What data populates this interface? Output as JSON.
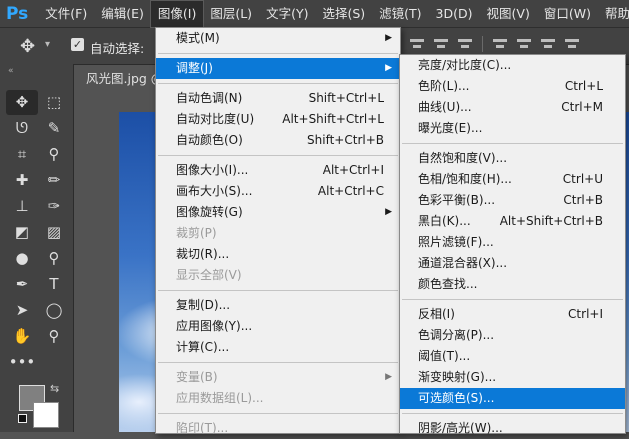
{
  "app": {
    "logo": "Ps"
  },
  "menubar": [
    "文件(F)",
    "编辑(E)",
    "图像(I)",
    "图层(L)",
    "文字(Y)",
    "选择(S)",
    "滤镜(T)",
    "3D(D)",
    "视图(V)",
    "窗口(W)",
    "帮助"
  ],
  "options": {
    "move_icon": "✥",
    "caret": "▾",
    "checkbox_mark": "✓",
    "auto_select_label": "自动选择:"
  },
  "document": {
    "tab_label": "风光图.jpg @"
  },
  "toolbox": {
    "collapse": "«",
    "tools": [
      {
        "name": "move-tool-icon",
        "glyph": "✥",
        "selected": true
      },
      {
        "name": "marquee-tool-icon",
        "glyph": "⬚"
      },
      {
        "name": "lasso-tool-icon",
        "glyph": "ᘎ"
      },
      {
        "name": "quick-select-tool-icon",
        "glyph": "✎"
      },
      {
        "name": "crop-tool-icon",
        "glyph": "⌗"
      },
      {
        "name": "eyedropper-tool-icon",
        "glyph": "⚲"
      },
      {
        "name": "healing-brush-tool-icon",
        "glyph": "✚"
      },
      {
        "name": "brush-tool-icon",
        "glyph": "✏"
      },
      {
        "name": "stamp-tool-icon",
        "glyph": "⊥"
      },
      {
        "name": "history-brush-tool-icon",
        "glyph": "✑"
      },
      {
        "name": "eraser-tool-icon",
        "glyph": "◩"
      },
      {
        "name": "gradient-tool-icon",
        "glyph": "▨"
      },
      {
        "name": "blur-tool-icon",
        "glyph": "●"
      },
      {
        "name": "dodge-tool-icon",
        "glyph": "⚲"
      },
      {
        "name": "pen-tool-icon",
        "glyph": "✒"
      },
      {
        "name": "type-tool-icon",
        "glyph": "T"
      },
      {
        "name": "path-select-tool-icon",
        "glyph": "➤"
      },
      {
        "name": "ellipse-tool-icon",
        "glyph": "◯"
      },
      {
        "name": "hand-tool-icon",
        "glyph": "✋"
      },
      {
        "name": "zoom-tool-icon",
        "glyph": "⚲"
      },
      {
        "name": "more-tools-icon",
        "glyph": "•••"
      },
      {
        "name": "empty-slot",
        "glyph": ""
      }
    ],
    "swap": "⇆"
  },
  "image_menu": [
    {
      "label": "模式(M)",
      "arrow": "▶"
    },
    {
      "sep": true
    },
    {
      "label": "调整(J)",
      "arrow": "▶",
      "highlighted": true
    },
    {
      "sep": true
    },
    {
      "label": "自动色调(N)",
      "shortcut": "Shift+Ctrl+L"
    },
    {
      "label": "自动对比度(U)",
      "shortcut": "Alt+Shift+Ctrl+L"
    },
    {
      "label": "自动颜色(O)",
      "shortcut": "Shift+Ctrl+B"
    },
    {
      "sep": true
    },
    {
      "label": "图像大小(I)...",
      "shortcut": "Alt+Ctrl+I"
    },
    {
      "label": "画布大小(S)...",
      "shortcut": "Alt+Ctrl+C"
    },
    {
      "label": "图像旋转(G)",
      "arrow": "▶"
    },
    {
      "label": "裁剪(P)",
      "disabled": true
    },
    {
      "label": "裁切(R)..."
    },
    {
      "label": "显示全部(V)",
      "disabled": true
    },
    {
      "sep": true
    },
    {
      "label": "复制(D)..."
    },
    {
      "label": "应用图像(Y)..."
    },
    {
      "label": "计算(C)..."
    },
    {
      "sep": true
    },
    {
      "label": "变量(B)",
      "arrow": "▶",
      "disabled": true
    },
    {
      "label": "应用数据组(L)...",
      "disabled": true
    },
    {
      "sep": true
    },
    {
      "label": "陷印(T)...",
      "disabled": true
    }
  ],
  "adjust_menu": [
    {
      "label": "亮度/对比度(C)..."
    },
    {
      "label": "色阶(L)...",
      "shortcut": "Ctrl+L"
    },
    {
      "label": "曲线(U)...",
      "shortcut": "Ctrl+M"
    },
    {
      "label": "曝光度(E)..."
    },
    {
      "sep": true
    },
    {
      "label": "自然饱和度(V)..."
    },
    {
      "label": "色相/饱和度(H)...",
      "shortcut": "Ctrl+U"
    },
    {
      "label": "色彩平衡(B)...",
      "shortcut": "Ctrl+B"
    },
    {
      "label": "黑白(K)...",
      "shortcut": "Alt+Shift+Ctrl+B"
    },
    {
      "label": "照片滤镜(F)..."
    },
    {
      "label": "通道混合器(X)..."
    },
    {
      "label": "颜色查找..."
    },
    {
      "sep": true
    },
    {
      "label": "反相(I)",
      "shortcut": "Ctrl+I"
    },
    {
      "label": "色调分离(P)..."
    },
    {
      "label": "阈值(T)..."
    },
    {
      "label": "渐变映射(G)..."
    },
    {
      "label": "可选颜色(S)...",
      "highlighted": true
    },
    {
      "sep": true
    },
    {
      "label": "阴影/高光(W)..."
    }
  ],
  "colors": {
    "accent": "#0b79d7",
    "menu_bg": "#f0f0f0",
    "chrome": "#424242",
    "workspace": "#535353",
    "ps_blue": "#31a8ff"
  }
}
